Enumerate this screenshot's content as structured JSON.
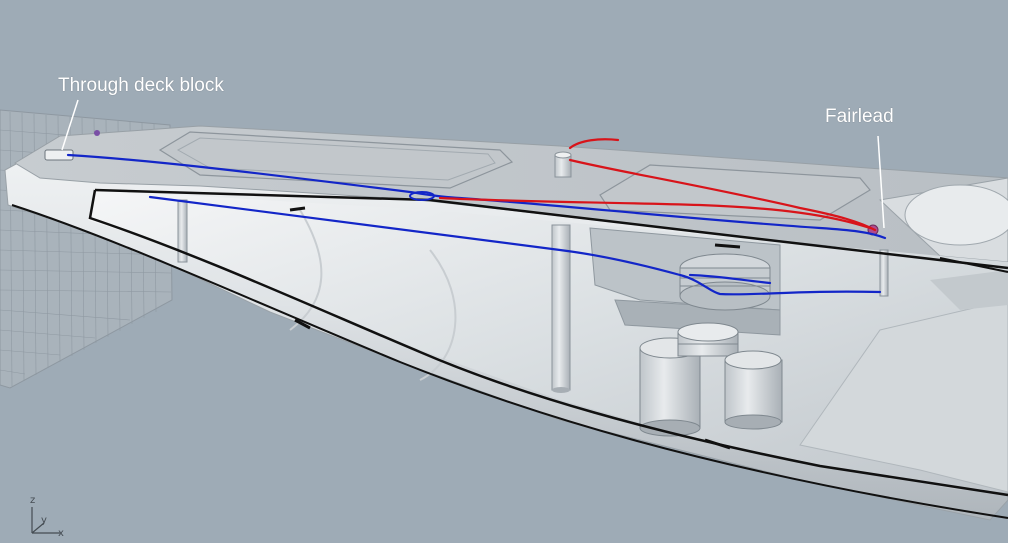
{
  "annotations": {
    "through_deck_block": "Through deck block",
    "fairlead": "Fairlead"
  },
  "axis_gizmo": {
    "z": "z",
    "y": "y",
    "x": "x"
  },
  "colors": {
    "background": "#9eabb6",
    "hull_light": "#e9ecee",
    "hull_shadow": "#b5bcc2",
    "deck": "#c9cdd1",
    "blue_line": "#1326c8",
    "red_line": "#d8141a",
    "outline": "#111111"
  }
}
